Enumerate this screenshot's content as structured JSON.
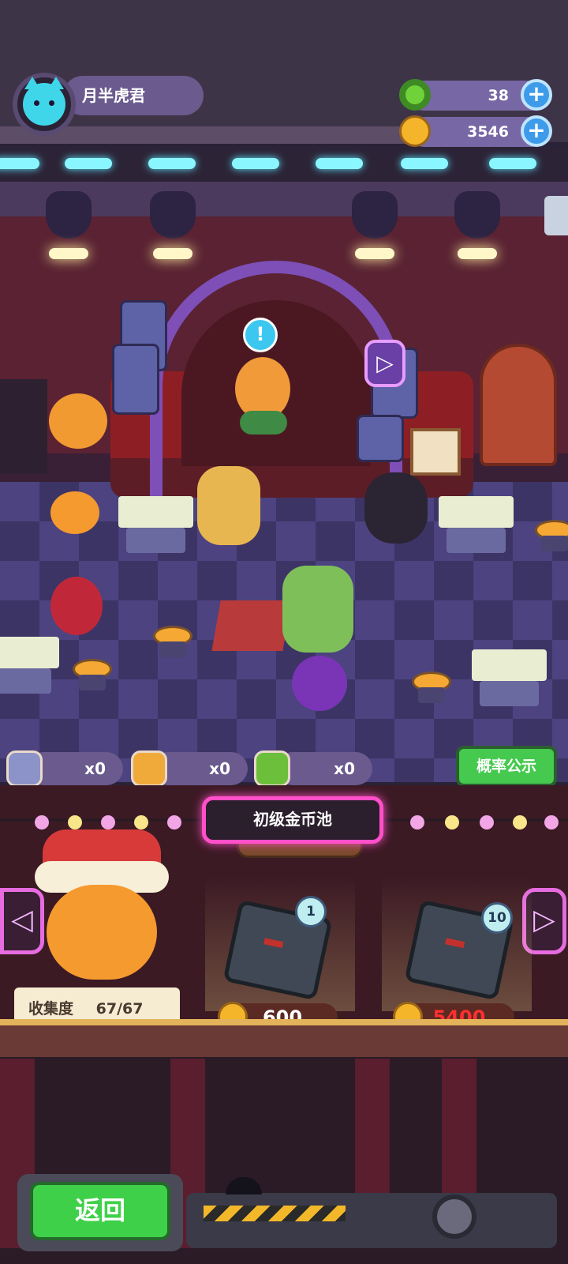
{
  "player": {
    "name": "月半虎君"
  },
  "resources": {
    "gems": {
      "value": "38",
      "icon": "green-donut-icon"
    },
    "coins": {
      "value": "3546",
      "icon": "gold-coin-icon"
    }
  },
  "items": [
    {
      "count": "x0",
      "icon": "blue-bottle-cap-icon"
    },
    {
      "count": "x0",
      "icon": "gold-bottle-cap-icon"
    },
    {
      "count": "x0",
      "icon": "green-bottle-cap-icon"
    }
  ],
  "probability_button": "概率公示",
  "pool": {
    "title": "初级金币池"
  },
  "collection": {
    "label": "收集度",
    "value": "67/67"
  },
  "draws": [
    {
      "qty": "1",
      "price": "600",
      "price_color": "#ffffff"
    },
    {
      "qty": "10",
      "price": "5400",
      "price_color": "#ff3030"
    }
  ],
  "back_button": "返回",
  "colors": {
    "accent_pink": "#ff4fc9",
    "green_button": "#45c94e",
    "coin_gold": "#f4b52a"
  }
}
